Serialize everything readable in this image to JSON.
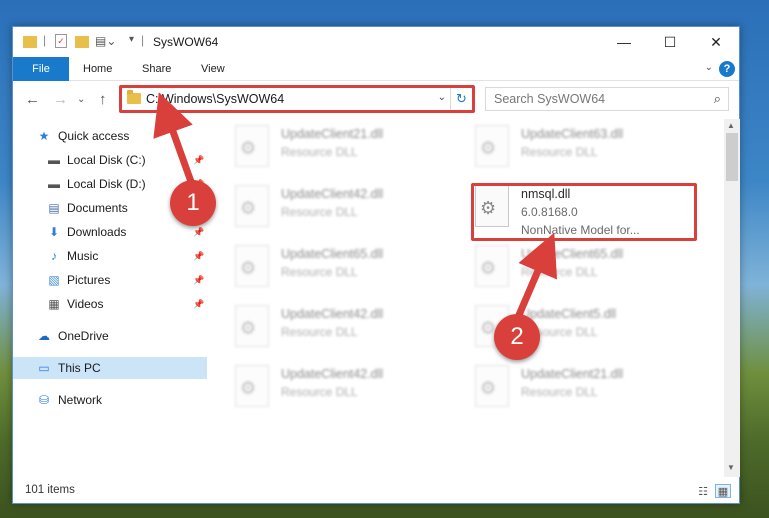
{
  "window": {
    "title": "SysWOW64",
    "controls": {
      "minimize": "—",
      "maximize": "☐",
      "close": "✕"
    }
  },
  "ribbon": {
    "tabs": [
      {
        "label": "File"
      },
      {
        "label": "Home"
      },
      {
        "label": "Share"
      },
      {
        "label": "View"
      }
    ],
    "help": "?",
    "collapse": "⌄"
  },
  "nav": {
    "back": "←",
    "forward": "→",
    "recent": "⌄",
    "up": "↑"
  },
  "address": {
    "path": "C:\\Windows\\SysWOW64",
    "dropdown": "⌄",
    "refresh": "↻"
  },
  "search": {
    "placeholder": "Search SysWOW64",
    "icon": "⌕"
  },
  "sidebar": {
    "items": [
      {
        "label": "Quick access",
        "icon": "star-icon",
        "glyph": "★",
        "color": "#2b7de0",
        "pinned": false
      },
      {
        "label": "Local Disk (C:)",
        "icon": "drive-icon",
        "glyph": "▬",
        "color": "#555555",
        "pinned": true
      },
      {
        "label": "Local Disk (D:)",
        "icon": "drive-icon",
        "glyph": "▬",
        "color": "#555555",
        "pinned": true
      },
      {
        "label": "Documents",
        "icon": "documents-icon",
        "glyph": "▤",
        "color": "#4a6fa5",
        "pinned": true
      },
      {
        "label": "Downloads",
        "icon": "downloads-icon",
        "glyph": "⬇",
        "color": "#2b7de0",
        "pinned": true
      },
      {
        "label": "Music",
        "icon": "music-icon",
        "glyph": "♪",
        "color": "#2b7de0",
        "pinned": true
      },
      {
        "label": "Pictures",
        "icon": "pictures-icon",
        "glyph": "▧",
        "color": "#3f8ad6",
        "pinned": true
      },
      {
        "label": "Videos",
        "icon": "videos-icon",
        "glyph": "▦",
        "color": "#555555",
        "pinned": true
      },
      {
        "label": "OneDrive",
        "icon": "onedrive-icon",
        "glyph": "☁",
        "color": "#1a68c4",
        "pinned": false
      },
      {
        "label": "This PC",
        "icon": "this-pc-icon",
        "glyph": "▭",
        "color": "#2b7de0",
        "pinned": false
      },
      {
        "label": "Network",
        "icon": "network-icon",
        "glyph": "⛁",
        "color": "#2b7de0",
        "pinned": false
      }
    ],
    "pin_glyph": "📌"
  },
  "files": [
    {
      "name": "UpdateClient21.dll",
      "sub": "Resource DLL",
      "blurred": true
    },
    {
      "name": "UpdateClient63.dll",
      "sub": "Resource DLL",
      "blurred": true
    },
    {
      "name": "UpdateClient42.dll",
      "sub": "Resource DLL",
      "blurred": true
    },
    {
      "name": "nmsql.dll",
      "sub": "6.0.8168.0",
      "sub2": "NonNative Model for...",
      "blurred": false
    },
    {
      "name": "UpdateClient65.dll",
      "sub": "Resource DLL",
      "blurred": true
    },
    {
      "name": "UpdateClient65.dll",
      "sub": "Resource DLL",
      "blurred": true
    },
    {
      "name": "UpdateClient42.dll",
      "sub": "Resource DLL",
      "blurred": true
    },
    {
      "name": "UpdateClient5.dll",
      "sub": "Resource DLL",
      "blurred": true
    },
    {
      "name": "UpdateClient42.dll",
      "sub": "Resource DLL",
      "blurred": true
    },
    {
      "name": "UpdateClient21.dll",
      "sub": "Resource DLL",
      "blurred": true
    }
  ],
  "status": {
    "count": "101 items"
  },
  "callouts": {
    "one": "1",
    "two": "2"
  },
  "colors": {
    "accent": "#1979ca",
    "highlight": "#d9403b",
    "selection": "#cce4f7"
  }
}
